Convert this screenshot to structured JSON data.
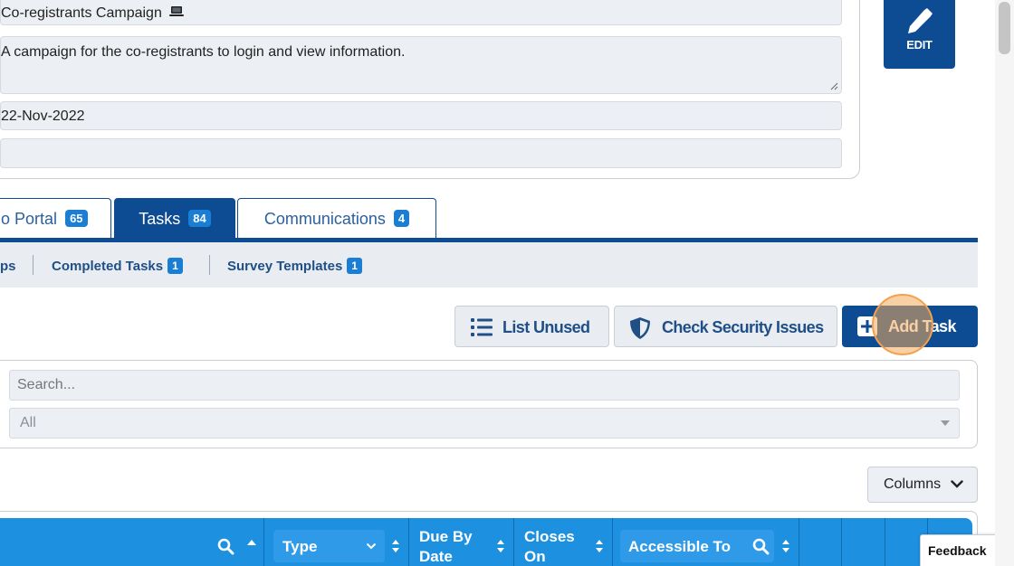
{
  "campaign": {
    "name": "Co-registrants Campaign",
    "description": "A campaign for the co-registrants to login and view information.",
    "date": "22-Nov-2022",
    "extra_field": "",
    "edit_label": "EDIT"
  },
  "tabs": [
    {
      "label": "o Portal",
      "count": "65"
    },
    {
      "label": "Tasks",
      "count": "84"
    },
    {
      "label": "Communications",
      "count": "4"
    }
  ],
  "subnav": [
    {
      "label": "ps"
    },
    {
      "label": "Completed Tasks",
      "count": "1"
    },
    {
      "label": "Survey Templates",
      "count": "1"
    }
  ],
  "actions": {
    "list_unused": "List Unused",
    "check_security": "Check Security Issues",
    "add_task": "Add Task"
  },
  "filters": {
    "search_placeholder": "Search...",
    "select_value": "All"
  },
  "columns_label": "Columns",
  "table_headers": {
    "type": "Type",
    "due_by_date": "Due By Date",
    "closes_on": "Closes On",
    "accessible_to": "Accessible To"
  },
  "feedback_label": "Feedback",
  "colors": {
    "primary": "#0d4c93",
    "badge": "#1a7fd4",
    "table_header": "#1e90e0",
    "highlight": "#f2a04e"
  }
}
